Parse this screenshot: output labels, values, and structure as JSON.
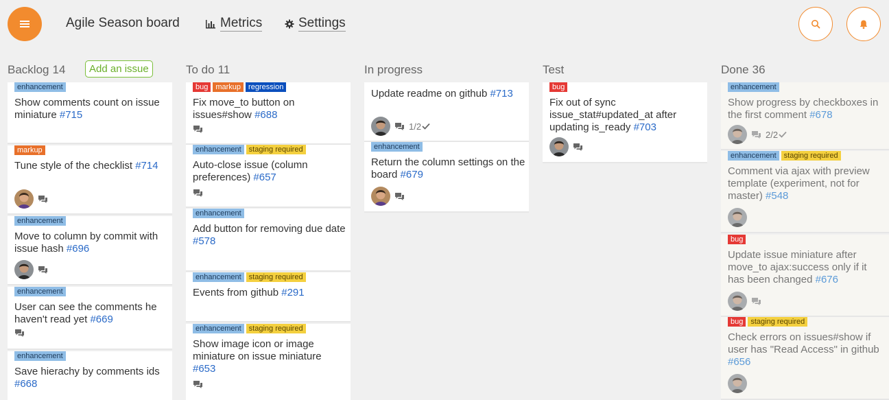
{
  "header": {
    "board_title": "Agile Season board",
    "metrics_label": "Metrics",
    "settings_label": "Settings"
  },
  "columns": [
    {
      "title": "Backlog",
      "count": "14",
      "add_issue_label": "Add an issue",
      "cards": [
        {
          "labels": [
            "enhancement"
          ],
          "title": "Show comments count on issue miniature",
          "number": "#715"
        },
        {
          "labels": [
            "markup"
          ],
          "title": "Tune style of the checklist",
          "number": "#714"
        },
        {
          "labels": [
            "enhancement"
          ],
          "title": "Move to column by commit with issue hash",
          "number": "#696"
        },
        {
          "labels": [
            "enhancement"
          ],
          "title": "User can see the comments he haven't read yet",
          "number": "#669"
        },
        {
          "labels": [
            "enhancement"
          ],
          "title": "Save hierachy by comments ids",
          "number": "#668"
        }
      ]
    },
    {
      "title": "To do",
      "count": "11",
      "cards": [
        {
          "labels": [
            "bug",
            "markup",
            "regression"
          ],
          "title": "Fix move_to button on issues#show",
          "number": "#688"
        },
        {
          "labels": [
            "enhancement",
            "staging required"
          ],
          "title": "Auto-close issue (column preferences)",
          "number": "#657"
        },
        {
          "labels": [
            "enhancement"
          ],
          "title": "Add button for removing due date",
          "number": "#578"
        },
        {
          "labels": [
            "enhancement",
            "staging required"
          ],
          "title": "Events from github",
          "number": "#291"
        },
        {
          "labels": [
            "enhancement",
            "staging required"
          ],
          "title": "Show image icon or image miniature on issue miniature",
          "number": "#653"
        }
      ]
    },
    {
      "title": "In progress",
      "count": "",
      "cards": [
        {
          "labels": [],
          "title": "Update readme on github",
          "number": "#713",
          "checklist": "1/2"
        },
        {
          "labels": [
            "enhancement"
          ],
          "title": "Return the column settings on the board",
          "number": "#679"
        }
      ]
    },
    {
      "title": "Test",
      "count": "",
      "cards": [
        {
          "labels": [
            "bug"
          ],
          "title": "Fix out of sync issue_stat#updated_at after updating is_ready",
          "number": "#703"
        }
      ]
    },
    {
      "title": "Done",
      "count": "36",
      "cards": [
        {
          "labels": [
            "enhancement"
          ],
          "title": "Show progress by checkboxes in the first comment",
          "number": "#678",
          "checklist": "2/2"
        },
        {
          "labels": [
            "enhancement",
            "staging required"
          ],
          "title": "Comment via ajax with preview template (experiment, not for master)",
          "number": "#548"
        },
        {
          "labels": [
            "bug"
          ],
          "title": "Update issue miniature after move_to ajax:success only if it has been changed",
          "number": "#676"
        },
        {
          "labels": [
            "bug",
            "staging required"
          ],
          "title": "Check errors on issues#show if user has \"Read Access\" in github",
          "number": "#656"
        }
      ]
    }
  ],
  "colors": {
    "accent": "#f28b2e",
    "add_issue_green": "#7bbf3a",
    "issue_link": "#2a6ac8",
    "label_enhancement": "#8fbde6",
    "label_markup": "#e8702a",
    "label_bug": "#e53935",
    "label_regression": "#0b4fbd",
    "label_staging": "#f4d03f"
  },
  "icons": [
    "menu-icon",
    "bar-chart-icon",
    "gear-icon",
    "search-icon",
    "bell-icon",
    "comment-icon",
    "checkmark-icon"
  ]
}
